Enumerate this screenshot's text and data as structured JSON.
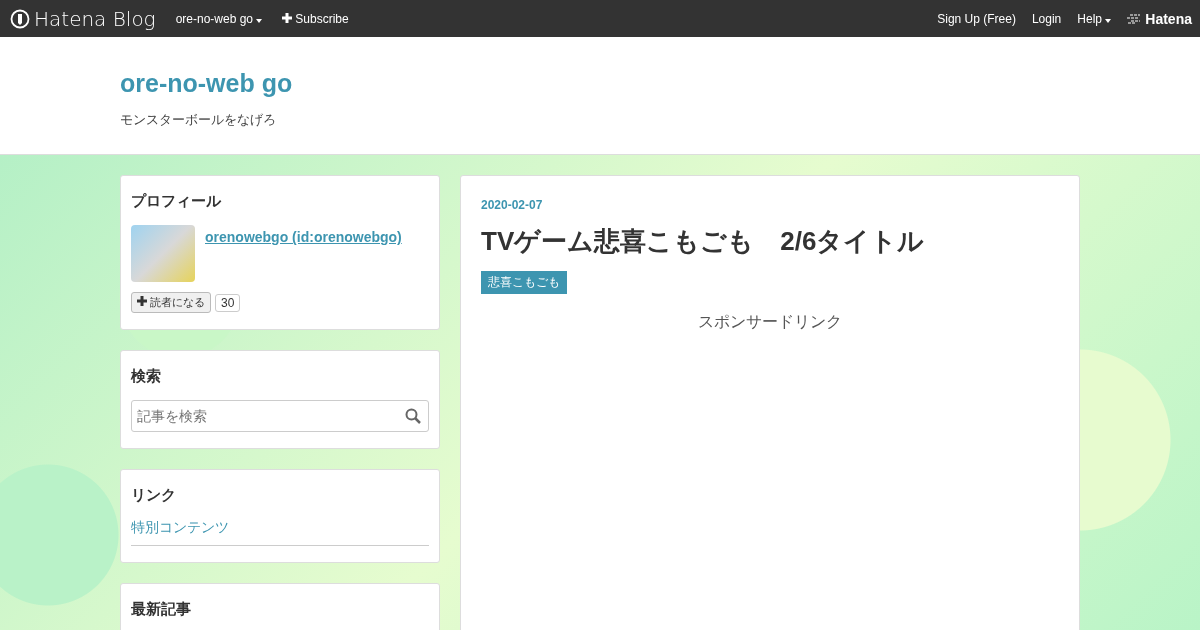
{
  "global_header": {
    "logo": "Hatena Blog",
    "blog_menu": "ore-no-web go",
    "subscribe": "Subscribe",
    "sign_up": "Sign Up (Free)",
    "login": "Login",
    "help": "Help",
    "brand": "Hatena"
  },
  "blog_header": {
    "title": "ore-no-web go",
    "description": "モンスターボールをなげろ"
  },
  "sidebar": {
    "profile": {
      "heading": "プロフィール",
      "name": "orenowebgo (id:orenowebgo)",
      "subscribe_button": "読者になる",
      "subscriber_count": "30"
    },
    "search": {
      "heading": "検索",
      "placeholder": "記事を検索"
    },
    "links": {
      "heading": "リンク",
      "items": [
        "特別コンテンツ"
      ]
    },
    "recent": {
      "heading": "最新記事"
    }
  },
  "entry": {
    "date": "2020-02-07",
    "title": "TVゲーム悲喜こもごも　2/6タイトル",
    "categories": [
      "悲喜こもごも"
    ],
    "sponsor_label": "スポンサードリンク"
  }
}
